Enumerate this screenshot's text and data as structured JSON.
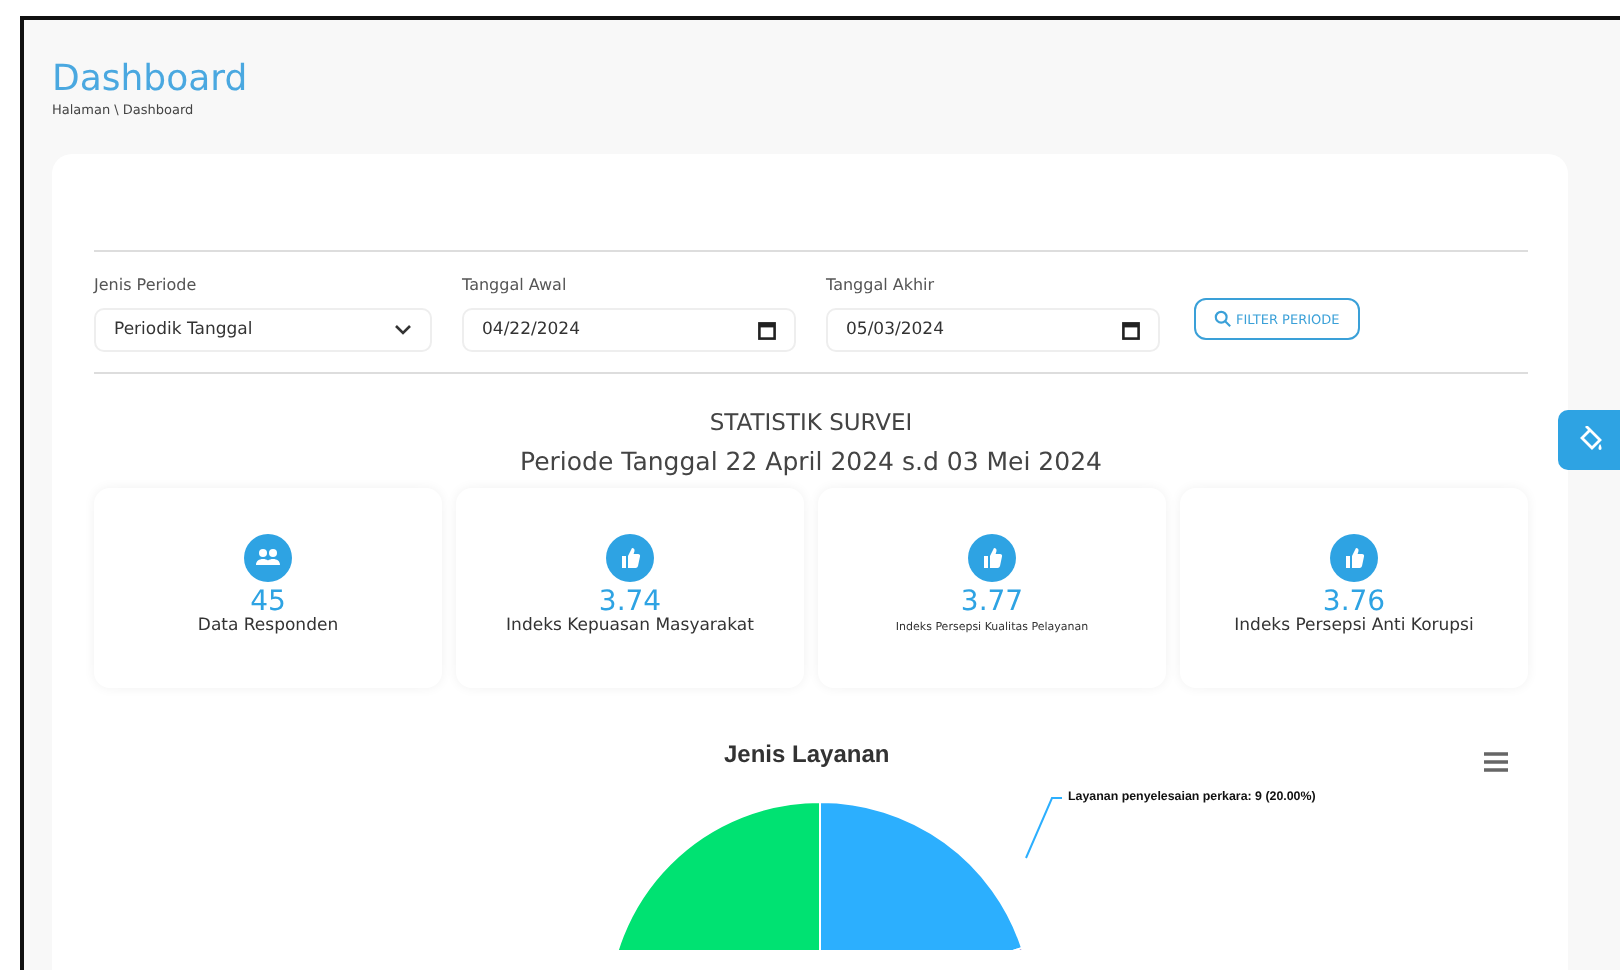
{
  "page": {
    "title": "Dashboard",
    "breadcrumb": "Halaman \\ Dashboard"
  },
  "filters": [
    {
      "kind": "select",
      "label": "Jenis Periode",
      "value": "Periodik Tanggal"
    },
    {
      "kind": "date",
      "label": "Tanggal Awal",
      "value": "04/22/2024"
    },
    {
      "kind": "date",
      "label": "Tanggal Akhir",
      "value": "05/03/2024"
    }
  ],
  "filter_button": "FILTER PERIODE",
  "statistics": {
    "title": "STATISTIK SURVEI",
    "period": "Periode Tanggal 22 April 2024 s.d 03 Mei 2024",
    "cards": [
      {
        "kind": "users",
        "value": "45",
        "label": "Data Responden",
        "compact": false
      },
      {
        "kind": "thumb",
        "value": "3.74",
        "label": "Indeks Kepuasan Masyarakat",
        "compact": false
      },
      {
        "kind": "thumb",
        "value": "3.77",
        "label": "Indeks Persepsi Kualitas Pelayanan",
        "compact": true
      },
      {
        "kind": "thumb",
        "value": "3.76",
        "label": "Indeks Persepsi Anti Korupsi",
        "compact": false
      }
    ]
  },
  "chart": {
    "title": "Jenis Layanan",
    "label": "Layanan penyelesaian perkara: 9 (20.00%)"
  }
}
